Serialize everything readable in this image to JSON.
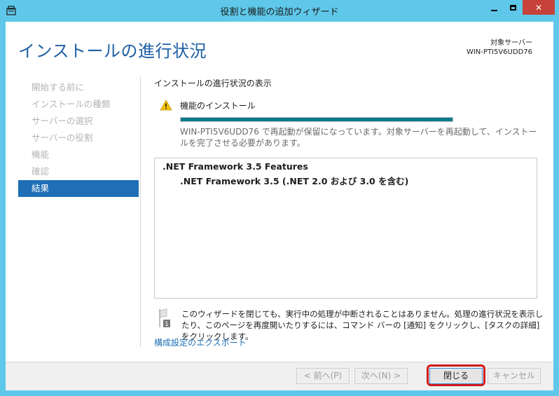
{
  "window": {
    "title": "役割と機能の追加ウィザード",
    "controls": {
      "minimize": "minimize",
      "maximize": "maximize",
      "close": "✕"
    }
  },
  "header": {
    "page_title": "インストールの進行状況",
    "target_label": "対象サーバー",
    "target_server": "WIN-PTI5V6UDD76"
  },
  "nav": {
    "items": [
      {
        "label": "開始する前に",
        "active": false
      },
      {
        "label": "インストールの種類",
        "active": false
      },
      {
        "label": "サーバーの選択",
        "active": false
      },
      {
        "label": "サーバーの役割",
        "active": false
      },
      {
        "label": "機能",
        "active": false
      },
      {
        "label": "確認",
        "active": false
      },
      {
        "label": "結果",
        "active": true
      }
    ]
  },
  "main": {
    "section_label": "インストールの進行状況の表示",
    "feature_install_label": "機能のインストール",
    "progress_fraction": 1.0,
    "restart_message": "WIN-PTI5V6UDD76 で再起動が保留になっています。対象サーバーを再起動して、インストールを完了させる必要があります。",
    "results": [
      ".NET Framework 3.5 Features",
      ".NET Framework 3.5 (.NET 2.0 および 3.0 を含む)"
    ],
    "info_badge": "1",
    "info_text": "このウィザードを閉じても、実行中の処理が中断されることはありません。処理の進行状況を表示したり、このページを再度開いたりするには、コマンド バーの [通知] をクリックし、[タスクの詳細] をクリックします。",
    "export_link": "構成設定のエクスポート"
  },
  "footer": {
    "prev": "< 前へ(P)",
    "next": "次へ(N) >",
    "close": "閉じる",
    "cancel": "キャンセル"
  },
  "colors": {
    "titlebar": "#5fc8ea",
    "accent": "#1e6fb5",
    "progress": "#0a7a8c",
    "highlight": "#d21a1a"
  }
}
